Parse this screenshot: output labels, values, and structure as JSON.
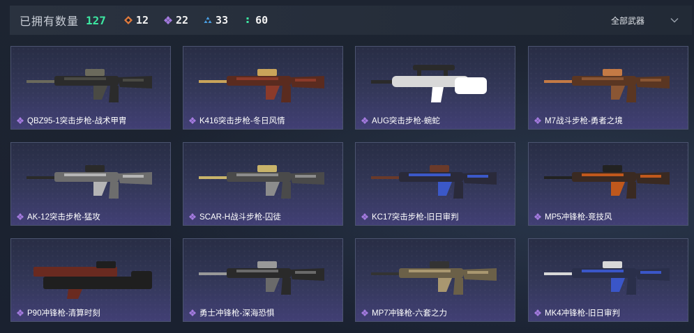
{
  "header": {
    "owned_label": "已拥有数量",
    "owned_count": "127",
    "stats": [
      {
        "icon": "orange-diamond-icon",
        "color": "#e07a3c",
        "value": "12"
      },
      {
        "icon": "purple-diamond-icon",
        "color": "#a57be0",
        "value": "22"
      },
      {
        "icon": "blue-cluster-icon",
        "color": "#4a9fe3",
        "value": "33"
      },
      {
        "icon": "green-dots-icon",
        "color": "#3de6a1",
        "value": "60"
      }
    ],
    "filter_label": "全部武器"
  },
  "colors": {
    "accent_green": "#3de6a1",
    "rarity_purple": "#a57be0"
  },
  "weapons": [
    {
      "name": "QBZ95-1突击步枪-战术甲胄",
      "style": "dark"
    },
    {
      "name": "K416突击步枪-冬日风情",
      "style": "red"
    },
    {
      "name": "AUG突击步枪-蜿蛇",
      "style": "white"
    },
    {
      "name": "M7战斗步枪-勇者之境",
      "style": "bronze"
    },
    {
      "name": "AK-12突击步枪-猛攻",
      "style": "silver"
    },
    {
      "name": "SCAR-H战斗步枪-囚徒",
      "style": "camo"
    },
    {
      "name": "KC17突击步枪-旧日审判",
      "style": "blue"
    },
    {
      "name": "MP5冲锋枪-竞技风",
      "style": "orange"
    },
    {
      "name": "P90冲锋枪-清算时刻",
      "style": "p90"
    },
    {
      "name": "勇士冲锋枪-深海恐惧",
      "style": "darkgray"
    },
    {
      "name": "MP7冲锋枪-六套之力",
      "style": "tan"
    },
    {
      "name": "MK4冲锋枪-旧日审判",
      "style": "blue2"
    }
  ]
}
